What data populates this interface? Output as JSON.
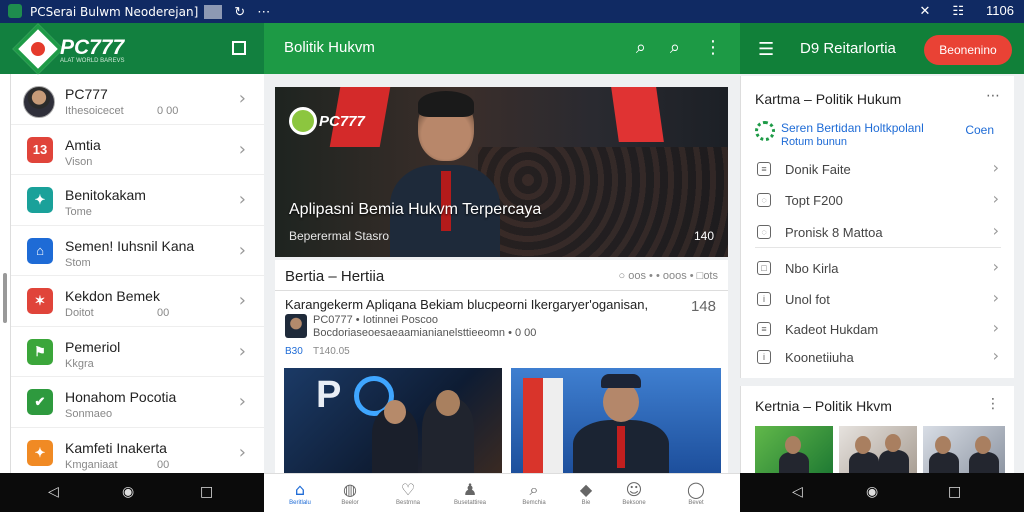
{
  "statusbar": {
    "title": "PCSerai Bulwm Neoderejan]",
    "time": "1106",
    "icons": [
      "pc-icon",
      "gallery-icon",
      "refresh-icon",
      "more-icon",
      "close-icon",
      "screen-icon"
    ]
  },
  "left": {
    "brand": "PC777",
    "tagline": "ALAT WORLD BAREVS",
    "items": [
      {
        "name": "PC777",
        "sub": "Ithesoicecet",
        "meta": "0 00",
        "icon": "avatar",
        "color": "#2b2b2b",
        "glyph": ""
      },
      {
        "name": "Amtia",
        "sub": "Vison",
        "meta": "",
        "icon": "news-icon",
        "color": "#e0443a",
        "glyph": "13"
      },
      {
        "name": "Benitokakam",
        "sub": "Tome",
        "meta": "",
        "icon": "bird-icon",
        "color": "#1aa19a",
        "glyph": "✦"
      },
      {
        "name": "Semen! Iuhsnil Kana",
        "sub": "Stom",
        "meta": "",
        "icon": "home-icon",
        "color": "#1e6bd6",
        "glyph": "⌂"
      },
      {
        "name": "Kekdon Bemek",
        "sub": "Doitot",
        "meta": "00",
        "icon": "share-icon",
        "color": "#e0443a",
        "glyph": "✶"
      },
      {
        "name": "Pemeriol",
        "sub": "Kkgra",
        "meta": "",
        "icon": "flag-icon",
        "color": "#3ba63a",
        "glyph": "⚑"
      },
      {
        "name": "Honahom Pocotia",
        "sub": "Sonmaeo",
        "meta": "",
        "icon": "check-icon",
        "color": "#2e9a3e",
        "glyph": "✔"
      },
      {
        "name": "Kamfeti Inakerta",
        "sub": "Kmganiaat",
        "meta": "00",
        "icon": "bird-icon",
        "color": "#f08a24",
        "glyph": "✦"
      }
    ]
  },
  "middle": {
    "title": "Bolitik Hukvm",
    "hero": {
      "brand": "PC777",
      "title": "Aplipasni Bemia Hukvm Terpercaya",
      "subtitle": "Beperermal Stasro",
      "number": "140"
    },
    "news": {
      "heading": "Bertia – Hertiia",
      "meta": "○ oos • • ooos • □ots",
      "line": "Karangekerm Apliqana Bekiam blucpeorni Ikergaryer'oganisan,",
      "number": "148",
      "source1": "PC0777 • Iotinnei Poscoo",
      "source2": "Bocdoriaseoesaeaamianianelsttieeomn • 0 00",
      "time_prefix": "B30",
      "time": "T140.05"
    }
  },
  "tabbar": {
    "tabs": [
      {
        "label": "Beritlalu",
        "icon": "home-icon",
        "glyph": "⌂",
        "active": true
      },
      {
        "label": "Beelor",
        "icon": "chat-icon",
        "glyph": "◍",
        "active": false
      },
      {
        "label": "Bestrnna",
        "icon": "heart-icon",
        "glyph": "♡",
        "active": false
      },
      {
        "label": "Busetattirea",
        "icon": "user-icon",
        "glyph": "♟",
        "active": false
      },
      {
        "label": "Bemchia",
        "icon": "search-icon",
        "glyph": "⌕",
        "active": false
      },
      {
        "label": "Bie",
        "icon": "shield-icon",
        "glyph": "◆",
        "active": false
      },
      {
        "label": "Beksone",
        "icon": "people-icon",
        "glyph": "☺",
        "active": false
      },
      {
        "label": "Bevet",
        "icon": "chat-bubble-icon",
        "glyph": "◯",
        "active": false
      }
    ]
  },
  "right": {
    "title": "D9 Reitarlortia",
    "button": "Beonenino",
    "card1": {
      "title": "Kartma – Politik Hukum",
      "banner_line1": "Seren Bertidan Holtkpolanl",
      "banner_line2": "Rotum bunun",
      "banner_action": "Coen",
      "rows": [
        {
          "label": "Donik Faite",
          "icon": "list-icon"
        },
        {
          "label": "Topt F200",
          "icon": "chat-icon"
        },
        {
          "label": "Pronisk 8 Mattoa",
          "icon": "chat-icon"
        },
        {
          "label": "Nbo Kirla",
          "icon": "box-icon"
        },
        {
          "label": "Unol fot",
          "icon": "info-icon"
        },
        {
          "label": "Kadeot Hukdam",
          "icon": "doc-icon"
        },
        {
          "label": "Koonetiiuha",
          "icon": "info-icon"
        }
      ]
    },
    "card2": {
      "title": "Kertnia – Politik Hkvm"
    }
  },
  "navbar": {
    "back": "◁",
    "home": "◉",
    "recent": "□"
  }
}
